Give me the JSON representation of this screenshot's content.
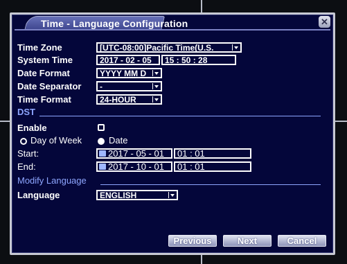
{
  "dialog": {
    "title": "Time - Language Configuration",
    "close_glyph": "✕"
  },
  "fields": {
    "time_zone": {
      "label": "Time Zone",
      "value": "[UTC-08:00]Pacific Time(U.S."
    },
    "system_time": {
      "label": "System Time",
      "date": "2017 - 02 - 05",
      "time": "15 : 50 : 28"
    },
    "date_format": {
      "label": "Date Format",
      "value": "YYYY MM D"
    },
    "date_separator": {
      "label": "Date Separator",
      "value": "-"
    },
    "time_format": {
      "label": "Time Format",
      "value": "24-HOUR"
    }
  },
  "dst": {
    "section_title": "DST",
    "enable_label": "Enable",
    "enabled": false,
    "mode_day_of_week": "Day of Week",
    "mode_date": "Date",
    "selected_mode": "Date",
    "start_label": "Start:",
    "start_date": "2017 - 05 - 01",
    "start_time": "01 : 01",
    "end_label": "End:",
    "end_date": "2017 - 10 - 01",
    "end_time": "01 : 01"
  },
  "language": {
    "section_title": "Modify Language",
    "label": "Language",
    "value": "ENGLISH"
  },
  "buttons": {
    "previous": "Previous",
    "next": "Next",
    "cancel": "Cancel"
  },
  "colors": {
    "dialog_bg": "#04063a",
    "section_accent": "#8ea6ff",
    "text": "#ffffff"
  }
}
